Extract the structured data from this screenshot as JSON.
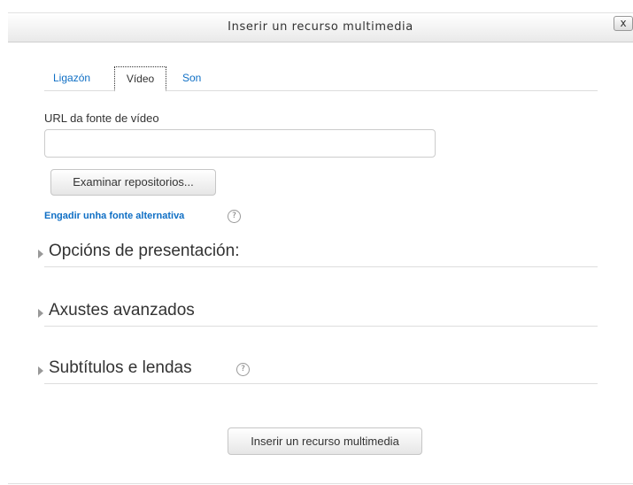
{
  "dialog": {
    "title": "Inserir un recurso multimedia",
    "close_label": "x"
  },
  "tabs": [
    {
      "label": "Ligazón"
    },
    {
      "label": "Vídeo",
      "active": true
    },
    {
      "label": "Son"
    }
  ],
  "video": {
    "url_label": "URL da fonte de vídeo",
    "url_value": "",
    "browse_button": "Examinar repositorios...",
    "alt_source_link": "Engadir unha fonte alternativa",
    "help_glyph": "?"
  },
  "sections": [
    {
      "label": "Opcións de presentación:",
      "icon": "expand-arrow-icon"
    },
    {
      "label": "Axustes avanzados",
      "icon": "expand-arrow-icon"
    },
    {
      "label": "Subtítulos e lendas",
      "icon": "expand-arrow-icon",
      "help": "?"
    }
  ],
  "footer": {
    "submit_button": "Inserir un recurso multimedia"
  },
  "colors": {
    "link": "#0f6fc5",
    "text": "#333333",
    "divider": "#dddddd"
  }
}
